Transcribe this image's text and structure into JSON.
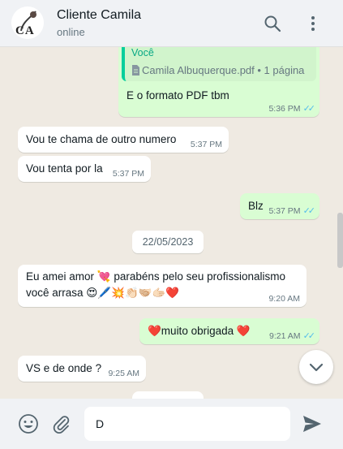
{
  "header": {
    "contact_name": "Cliente Camila",
    "status": "online",
    "avatar_initials": "CA"
  },
  "messages": {
    "m1": {
      "quote_author": "Você",
      "quote_file": "Camila Albuquerque.pdf • 1 página",
      "text": "E o formato PDF tbm",
      "time": "5:36 PM",
      "ticks": "✓✓"
    },
    "m2": {
      "text": "Vou te chama de outro numero",
      "time": "5:37 PM"
    },
    "m3": {
      "text": "Vou tenta por la",
      "time": "5:37 PM"
    },
    "m4": {
      "text": "Blz",
      "time": "5:37 PM",
      "ticks": "✓✓"
    },
    "date": "22/05/2023",
    "m5": {
      "line1": "Eu amei amor 💘  parabéns pelo seu profissionalismo",
      "line2": "você arrasa 😍🖊️💥👏🏻🫱🏼‍🫲🏻🫱🏻❤️",
      "time": "9:20 AM"
    },
    "m6": {
      "text": "❤️muito obrigada ❤️",
      "time": "9:21 AM",
      "ticks": "✓✓"
    },
    "m7": {
      "text": "VS e de onde ?",
      "time": "9:25 AM"
    }
  },
  "composer": {
    "value": "D"
  },
  "icons": [
    "search-icon",
    "menu-icon",
    "emoji-icon",
    "attach-icon",
    "send-icon",
    "chevron-down-icon"
  ],
  "colors": {
    "outgoing": "#d9fdd3",
    "incoming": "#ffffff",
    "read_ticks": "#53bdeb",
    "quote_bar": "#06cf9c",
    "background": "#efeae2"
  }
}
